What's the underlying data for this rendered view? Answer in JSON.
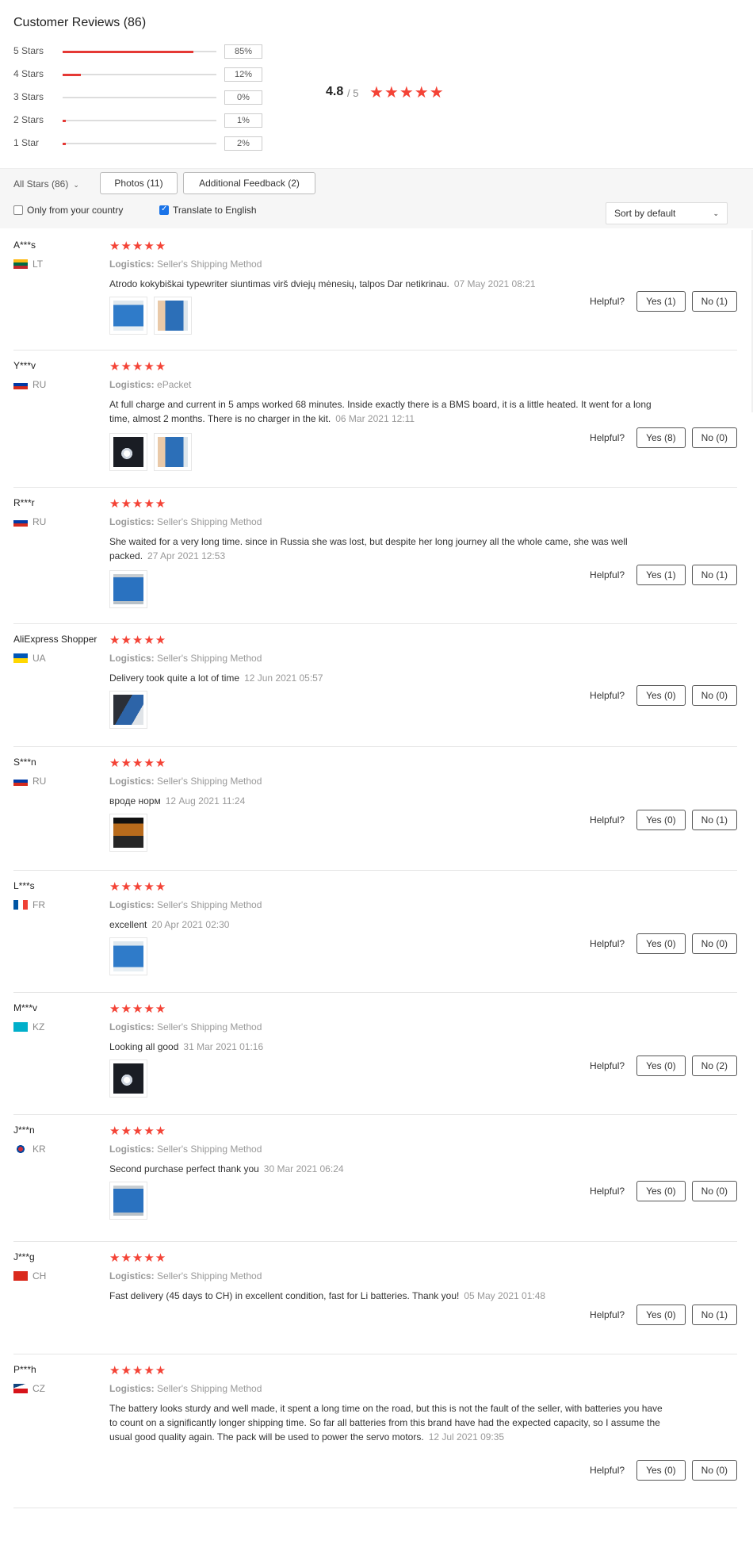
{
  "summary": {
    "title": "Customer Reviews (86)",
    "average": "4.8",
    "average_max": "/ 5",
    "stars_glyph": "★★★★★",
    "accent_color": "#e53935",
    "bars": [
      {
        "label": "5 Stars",
        "pct": "85%",
        "fill": 0.85
      },
      {
        "label": "4 Stars",
        "pct": "12%",
        "fill": 0.12
      },
      {
        "label": "3 Stars",
        "pct": "0%",
        "fill": 0.0
      },
      {
        "label": "2 Stars",
        "pct": "1%",
        "fill": 0.01
      },
      {
        "label": "1 Star",
        "pct": "2%",
        "fill": 0.02
      }
    ]
  },
  "filters": {
    "all_stars": "All Stars (86)",
    "photos": "Photos (11)",
    "additional": "Additional Feedback (2)",
    "only_country": "Only from your country",
    "only_country_checked": false,
    "translate": "Translate to English",
    "translate_checked": true,
    "sort": "Sort by default"
  },
  "helpful_label": "Helpful?",
  "logistics_label": "Logistics:",
  "reviews": [
    {
      "user": "A***s",
      "country": "LT",
      "flag": "lt",
      "stars": "★★★★★",
      "logistics": "Seller's Shipping Method",
      "text": "Atrodo kokybiškai typewriter siuntimas virš dviejų mėnesių, talpos Dar netikrinau.",
      "date": "07 May 2021 08:21",
      "photos": [
        "blue-pack",
        "blue-pack-hand"
      ],
      "yes": "Yes (1)",
      "no": "No (1)"
    },
    {
      "user": "Y***v",
      "country": "RU",
      "flag": "ru",
      "stars": "★★★★★",
      "logistics": "ePacket",
      "text": "At full charge and current in 5 amps worked 68 minutes. Inside exactly there is a BMS board, it is a little heated. It went for a long time, almost 2 months. There is no charger in the kit.",
      "date": "06 Mar 2021 12:11",
      "photos": [
        "dark-flash",
        "blue-pack-hand"
      ],
      "yes": "Yes (8)",
      "no": "No (0)"
    },
    {
      "user": "R***r",
      "country": "RU",
      "flag": "ru",
      "stars": "★★★★★",
      "logistics": "Seller's Shipping Method",
      "text": "She waited for a very long time. since in Russia she was lost, but despite her long journey all the whole came, she was well packed.",
      "date": "27 Apr 2021 12:53",
      "photos": [
        "blue-pack-large"
      ],
      "yes": "Yes (1)",
      "no": "No (1)"
    },
    {
      "user": "AliExpress Shopper",
      "country": "UA",
      "flag": "ua",
      "stars": "★★★★★",
      "logistics": "Seller's Shipping Method",
      "text": "Delivery took quite a lot of time",
      "date": "12 Jun 2021 05:57",
      "photos": [
        "dark-pack"
      ],
      "yes": "Yes (0)",
      "no": "No (0)"
    },
    {
      "user": "S***n",
      "country": "RU",
      "flag": "ru",
      "stars": "★★★★★",
      "logistics": "Seller's Shipping Method",
      "text": "вроде норм",
      "date": "12 Aug 2021 11:24",
      "photos": [
        "orange-pack"
      ],
      "yes": "Yes (0)",
      "no": "No (1)"
    },
    {
      "user": "L***s",
      "country": "FR",
      "flag": "fr",
      "stars": "★★★★★",
      "logistics": "Seller's Shipping Method",
      "text": "excellent",
      "date": "20 Apr 2021 02:30",
      "photos": [
        "blue-pack"
      ],
      "yes": "Yes (0)",
      "no": "No (0)"
    },
    {
      "user": "M***v",
      "country": "KZ",
      "flag": "kz",
      "stars": "★★★★★",
      "logistics": "Seller's Shipping Method",
      "text": "Looking all good",
      "date": "31 Mar 2021 01:16",
      "photos": [
        "dark-flash"
      ],
      "yes": "Yes (0)",
      "no": "No (2)"
    },
    {
      "user": "J***n",
      "country": "KR",
      "flag": "kr",
      "stars": "★★★★★",
      "logistics": "Seller's Shipping Method",
      "text": "Second purchase perfect thank you",
      "date": "30 Mar 2021 06:24",
      "photos": [
        "blue-pack-large"
      ],
      "yes": "Yes (0)",
      "no": "No (0)"
    },
    {
      "user": "J***g",
      "country": "CH",
      "flag": "ch",
      "stars": "★★★★★",
      "logistics": "Seller's Shipping Method",
      "text": "Fast delivery (45 days to CH) in excellent condition, fast for Li batteries. Thank you!",
      "date": "05 May 2021 01:48",
      "photos": [],
      "yes": "Yes (0)",
      "no": "No (1)"
    },
    {
      "user": "P***h",
      "country": "CZ",
      "flag": "cz",
      "stars": "★★★★★",
      "logistics": "Seller's Shipping Method",
      "text": "The battery looks sturdy and well made, it spent a long time on the road, but this is not the fault of the seller, with batteries you have to count on a significantly longer shipping time. So far all batteries from this brand have had the expected capacity, so I assume the usual good quality again. The pack will be used to power the servo motors.",
      "date": "12 Jul 2021 09:35",
      "photos": [],
      "yes": "Yes (0)",
      "no": "No (0)"
    }
  ]
}
